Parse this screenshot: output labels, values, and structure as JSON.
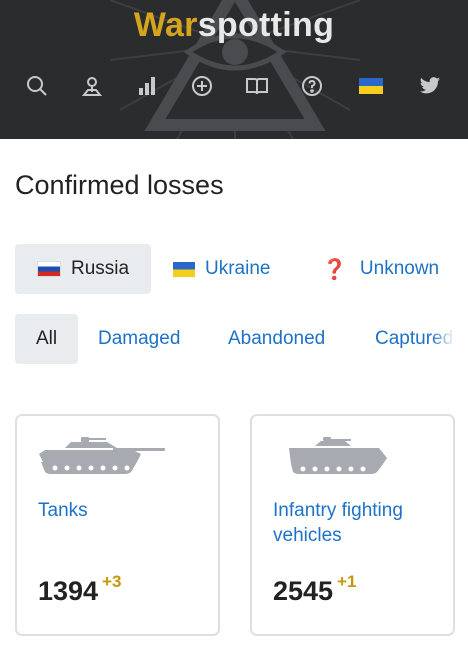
{
  "header": {
    "logo_part1": "War",
    "logo_part2": "spotting",
    "nav_icons": [
      "search-icon",
      "map-marker-icon",
      "stats-icon",
      "add-icon",
      "book-icon",
      "help-icon",
      "ukraine-flag-icon",
      "twitter-icon"
    ]
  },
  "page": {
    "title": "Confirmed losses"
  },
  "side_filter": [
    {
      "label": "Russia",
      "active": true,
      "icon": "russia-flag-icon"
    },
    {
      "label": "Ukraine",
      "active": false,
      "icon": "ukraine-flag-icon"
    },
    {
      "label": "Unknown",
      "active": false,
      "icon": "question-mark-icon"
    }
  ],
  "status_tabs": [
    "All",
    "Damaged",
    "Abandoned",
    "Captured"
  ],
  "cards": [
    {
      "name": "Tanks",
      "count": "1394",
      "delta": "+3",
      "icon": "tank-icon"
    },
    {
      "name": "Infantry fighting vehicles",
      "count": "2545",
      "delta": "+1",
      "icon": "ifv-icon"
    }
  ],
  "colors": {
    "header_bg": "#2b2c2e",
    "logo_accent": "#d7a51d",
    "link": "#1d72c7",
    "delta": "#c7970e",
    "active_bg": "#e9ecef"
  }
}
